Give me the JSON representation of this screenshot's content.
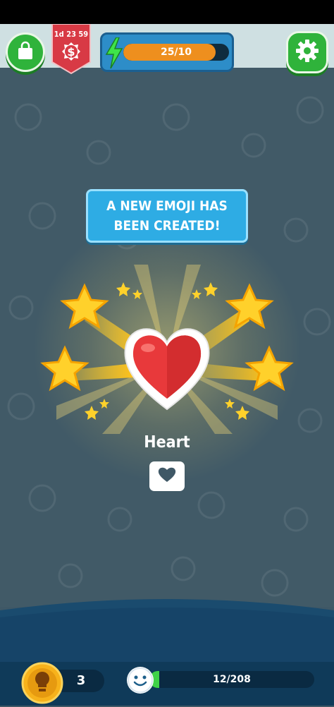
{
  "header": {
    "offer_timer": "1d 23 59",
    "offer_icon": "dollar-icon",
    "energy": {
      "label": "25/10",
      "fill_fraction": 0.87
    },
    "shop_icon": "shopping-bag-icon",
    "settings_icon": "gear-icon"
  },
  "main": {
    "banner_text": "A NEW EMOJI HAS BEEN CREATED!",
    "emoji_name": "Heart",
    "emoji_icon": "heart-icon"
  },
  "footer": {
    "hint_count": "3",
    "hint_icon": "lightbulb-icon",
    "progress_icon": "smiley-icon",
    "progress": {
      "label": "12/208",
      "fill_fraction": 0.0577
    }
  },
  "colors": {
    "background": "#415a67",
    "accent_green": "#2fb33b",
    "accent_blue": "#2eace4",
    "energy_orange": "#ee8f1e",
    "footer": "#0f3a59"
  }
}
